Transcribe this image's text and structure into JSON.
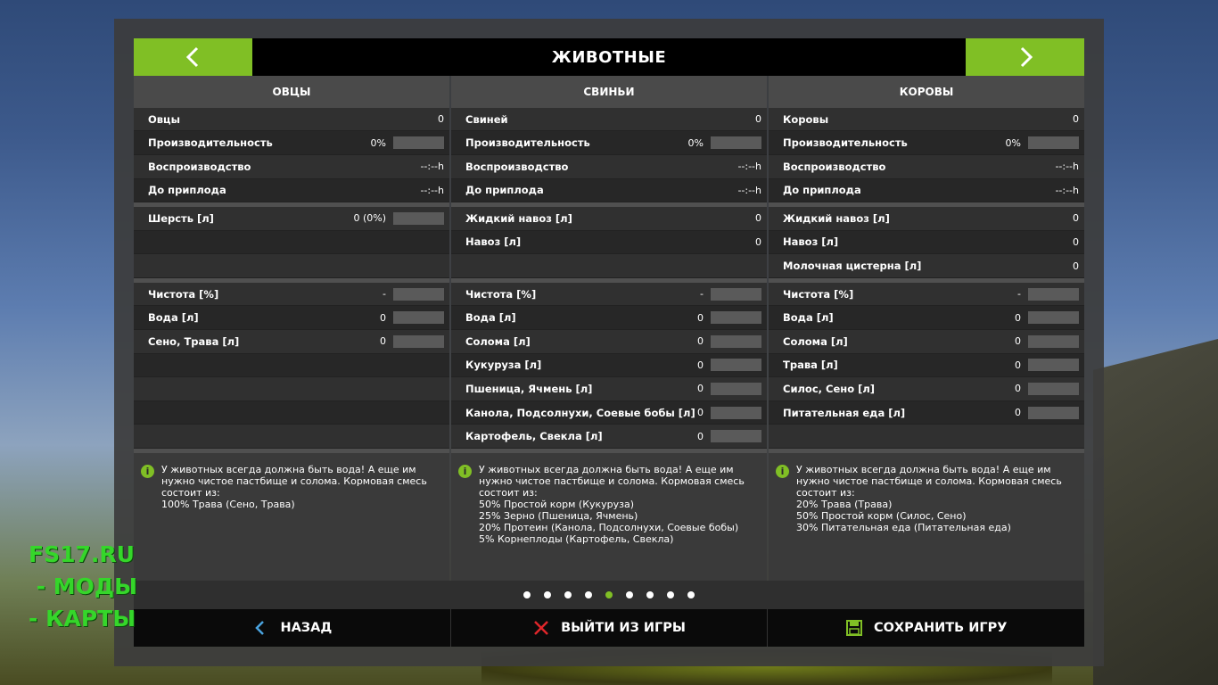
{
  "header": {
    "title": "ЖИВОТНЫЕ"
  },
  "columns": [
    {
      "title": "ОВЦЫ",
      "status": [
        {
          "label": "Овцы",
          "value": "0",
          "bar": false
        },
        {
          "label": "Производительность",
          "value": "0%",
          "bar": true
        },
        {
          "label": "Воспроизводство",
          "value": "--:--h",
          "bar": false
        },
        {
          "label": "До приплода",
          "value": "--:--h",
          "bar": false
        }
      ],
      "products": [
        {
          "label": "Шерсть [л]",
          "value": "0 (0%)",
          "bar": true
        },
        {
          "label": "",
          "value": "",
          "bar": false
        },
        {
          "label": "",
          "value": "",
          "bar": false
        }
      ],
      "needs": [
        {
          "label": "Чистота [%]",
          "value": "-",
          "bar": true
        },
        {
          "label": "Вода [л]",
          "value": "0",
          "bar": true
        },
        {
          "label": "Сено, Трава [л]",
          "value": "0",
          "bar": true
        },
        {
          "label": "",
          "value": "",
          "bar": false
        },
        {
          "label": "",
          "value": "",
          "bar": false
        },
        {
          "label": "",
          "value": "",
          "bar": false
        },
        {
          "label": "",
          "value": "",
          "bar": false
        }
      ],
      "info": "У животных всегда должна быть вода! А еще им нужно чистое пастбище и солома. Кормовая смесь состоит из:\n100% Трава (Сено, Трава)"
    },
    {
      "title": "СВИНЬИ",
      "status": [
        {
          "label": "Свиней",
          "value": "0",
          "bar": false
        },
        {
          "label": "Производительность",
          "value": "0%",
          "bar": true
        },
        {
          "label": "Воспроизводство",
          "value": "--:--h",
          "bar": false
        },
        {
          "label": "До приплода",
          "value": "--:--h",
          "bar": false
        }
      ],
      "products": [
        {
          "label": "Жидкий навоз [л]",
          "value": "0",
          "bar": false
        },
        {
          "label": "Навоз [л]",
          "value": "0",
          "bar": false
        },
        {
          "label": "",
          "value": "",
          "bar": false
        }
      ],
      "needs": [
        {
          "label": "Чистота [%]",
          "value": "-",
          "bar": true
        },
        {
          "label": "Вода [л]",
          "value": "0",
          "bar": true
        },
        {
          "label": "Солома [л]",
          "value": "0",
          "bar": true
        },
        {
          "label": "Кукуруза [л]",
          "value": "0",
          "bar": true
        },
        {
          "label": "Пшеница, Ячмень [л]",
          "value": "0",
          "bar": true
        },
        {
          "label": "Канола, Подсолнухи, Соевые бобы [л]",
          "value": "0",
          "bar": true
        },
        {
          "label": "Картофель, Свекла [л]",
          "value": "0",
          "bar": true
        }
      ],
      "info": "У животных всегда должна быть вода! А еще им нужно чистое пастбище и солома. Кормовая смесь состоит из:\n50% Простой корм (Кукуруза)\n25% Зерно (Пшеница, Ячмень)\n20% Протеин (Канола, Подсолнухи, Соевые бобы)\n5% Корнеплоды (Картофель, Свекла)"
    },
    {
      "title": "КОРОВЫ",
      "status": [
        {
          "label": "Коровы",
          "value": "0",
          "bar": false
        },
        {
          "label": "Производительность",
          "value": "0%",
          "bar": true
        },
        {
          "label": "Воспроизводство",
          "value": "--:--h",
          "bar": false
        },
        {
          "label": "До приплода",
          "value": "--:--h",
          "bar": false
        }
      ],
      "products": [
        {
          "label": "Жидкий навоз [л]",
          "value": "0",
          "bar": false
        },
        {
          "label": "Навоз [л]",
          "value": "0",
          "bar": false
        },
        {
          "label": "Молочная цистерна [л]",
          "value": "0",
          "bar": false
        }
      ],
      "needs": [
        {
          "label": "Чистота [%]",
          "value": "-",
          "bar": true
        },
        {
          "label": "Вода [л]",
          "value": "0",
          "bar": true
        },
        {
          "label": "Солома [л]",
          "value": "0",
          "bar": true
        },
        {
          "label": "Трава [л]",
          "value": "0",
          "bar": true
        },
        {
          "label": "Силос, Сено [л]",
          "value": "0",
          "bar": true
        },
        {
          "label": "Питательная еда [л]",
          "value": "0",
          "bar": true
        },
        {
          "label": "",
          "value": "",
          "bar": false
        }
      ],
      "info": "У животных всегда должна быть вода! А еще им нужно чистое пастбище и солома. Кормовая смесь состоит из:\n20% Трава (Трава)\n50% Простой корм (Силос, Сено)\n30% Питательная еда (Питательная еда)"
    }
  ],
  "pagination": {
    "total": 9,
    "active_index": 4
  },
  "bottom_bar": {
    "back_label": "НАЗАД",
    "quit_label": "ВЫЙТИ ИЗ ИГРЫ",
    "save_label": "СОХРАНИТЬ ИГРУ"
  },
  "watermark": "FS17.RU\n - МОДЫ\n- КАРТЫ",
  "colors": {
    "accent": "#80bf25",
    "quit_icon": "#e0262a",
    "watermark": "#35d62a"
  },
  "icons": {
    "prev": "chevron-left-icon",
    "next": "chevron-right-icon",
    "info": "info-icon",
    "back": "chevron-left-icon",
    "quit": "close-icon",
    "save": "save-icon"
  }
}
